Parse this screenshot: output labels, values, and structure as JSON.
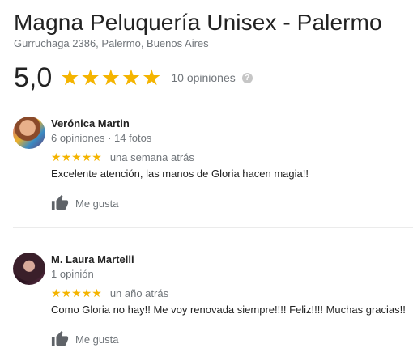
{
  "business": {
    "name": "Magna Peluquería Unisex - Palermo",
    "address": "Gurruchaga 2386, Palermo, Buenos Aires",
    "rating": "5,0",
    "stars": 5,
    "review_count": "10 opiniones",
    "help_icon_glyph": "?"
  },
  "colors": {
    "star": "#f4b400",
    "secondary_text": "#70757a"
  },
  "reviews": [
    {
      "author": "Verónica Martin",
      "meta": "6 opiniones · 14 fotos",
      "stars": 5,
      "time": "una semana atrás",
      "text": "Excelente atención, las manos de Gloria hacen magia!!",
      "like_label": "Me gusta"
    },
    {
      "author": "M. Laura Martelli",
      "meta": "1 opinión",
      "stars": 5,
      "time": "un año atrás",
      "text": "Como Gloria no hay!! Me voy renovada siempre!!!! Feliz!!!! Muchas gracias!!",
      "like_label": "Me gusta"
    }
  ]
}
